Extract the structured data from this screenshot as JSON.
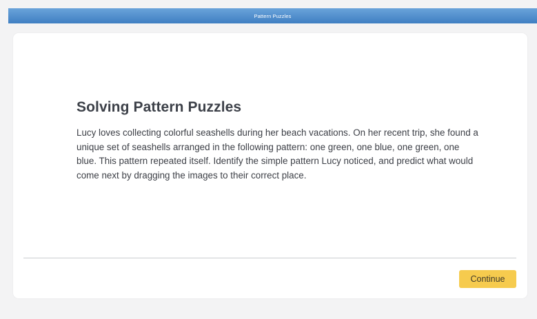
{
  "header": {
    "title": "Pattern Puzzles"
  },
  "lesson": {
    "heading": "Solving Pattern Puzzles",
    "body": "Lucy loves collecting colorful seashells during her beach vacations. On her recent trip, she found a unique set of seashells arranged in the following pattern: one green, one blue, one green, one blue. This pattern repeated itself. Identify the simple pattern Lucy noticed, and predict what would come next by dragging the images to their correct place."
  },
  "footer": {
    "continue_label": "Continue"
  },
  "colors": {
    "header_bar": "#4f8fd0",
    "continue_button": "#f6cb4e",
    "page_background": "#f3f3f4",
    "card_background": "#ffffff"
  }
}
